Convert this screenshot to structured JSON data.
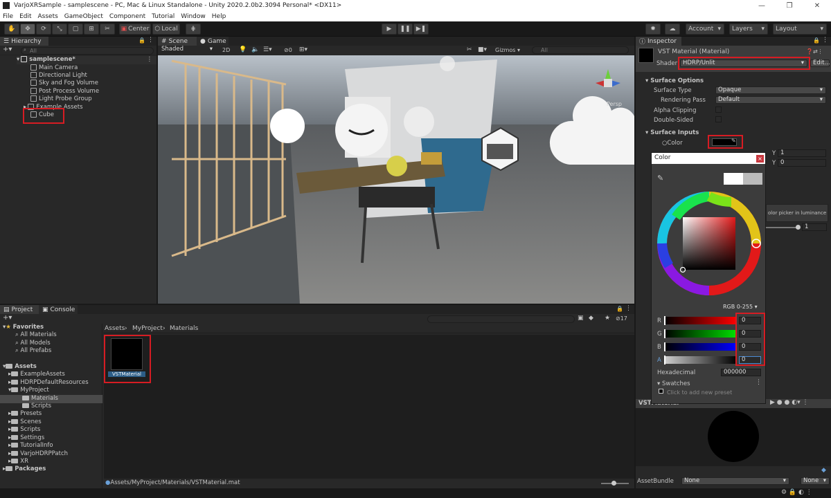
{
  "window": {
    "title": "VarjoXRSample - samplescene - PC, Mac & Linux Standalone - Unity 2020.2.0b2.3094 Personal* <DX11>"
  },
  "menu": [
    "File",
    "Edit",
    "Assets",
    "GameObject",
    "Component",
    "Tutorial",
    "Window",
    "Help"
  ],
  "toolbar": {
    "center": "Center",
    "local": "Local",
    "account": "Account",
    "layers": "Layers",
    "layout": "Layout"
  },
  "hierarchy": {
    "tab": "Hierarchy",
    "search": "All",
    "scene": "samplescene*",
    "items": [
      "Main Camera",
      "Directional Light",
      "Sky and Fog Volume",
      "Post Process Volume",
      "Light Probe Group",
      "Example Assets",
      "Cube"
    ]
  },
  "scene": {
    "tab_scene": "Scene",
    "tab_game": "Game",
    "shading": "Shaded",
    "mode_2d": "2D",
    "hidden_count": "0",
    "gizmos": "Gizmos",
    "search": "All",
    "persp": "Persp"
  },
  "project": {
    "tab_project": "Project",
    "tab_console": "Console",
    "favorites": "Favorites",
    "fav_items": [
      "All Materials",
      "All Models",
      "All Prefabs"
    ],
    "assets": "Assets",
    "asset_items": [
      "ExampleAssets",
      "HDRPDefaultResources",
      "MyProject",
      "Materials",
      "Scripts",
      "Presets",
      "Scenes",
      "Scripts",
      "Settings",
      "TutorialInfo",
      "VarjoHDRPPatch",
      "XR"
    ],
    "packages": "Packages",
    "breadcrumb": [
      "Assets",
      "MyProject",
      "Materials"
    ],
    "asset_name": "VSTMaterial",
    "asset_path": "Assets/MyProject/Materials/VSTMaterial.mat",
    "hidden_count": "17"
  },
  "inspector": {
    "tab": "Inspector",
    "title": "VST Material (Material)",
    "shader_label": "Shader",
    "shader_value": "HDRP/Unlit",
    "edit": "Edit...",
    "surface_options": "Surface Options",
    "surface_type_label": "Surface Type",
    "surface_type": "Opaque",
    "rendering_pass_label": "Rendering Pass",
    "rendering_pass": "Default",
    "alpha_clipping": "Alpha Clipping",
    "double_sided": "Double-Sided",
    "surface_inputs": "Surface Inputs",
    "color_label": "Color",
    "tiling_y": "1",
    "offset_y": "0",
    "y_label": "Y",
    "luminance_hint": "olor picker in luminance",
    "slider_value": "1",
    "preview_label": "VSTMaterial",
    "asset_bundle_label": "AssetBundle",
    "asset_bundle": "None",
    "asset_variant": "None"
  },
  "color_picker": {
    "title": "Color",
    "mode": "RGB 0-255",
    "r_label": "R",
    "g_label": "G",
    "b_label": "B",
    "a_label": "A",
    "r": "0",
    "g": "0",
    "b": "0",
    "a": "0",
    "hex_label": "Hexadecimal",
    "hex": "000000",
    "swatches": "Swatches",
    "add_preset": "Click to add new preset"
  }
}
